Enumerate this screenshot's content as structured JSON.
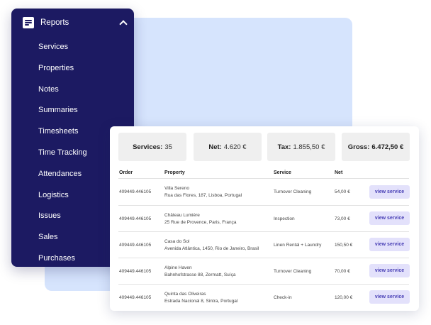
{
  "sidebar": {
    "title": "Reports",
    "header_icon": "document-icon",
    "toggle_icon": "chevron-up-icon",
    "items": [
      {
        "label": "Services"
      },
      {
        "label": "Properties"
      },
      {
        "label": "Notes"
      },
      {
        "label": "Summaries"
      },
      {
        "label": "Timesheets"
      },
      {
        "label": "Time Tracking"
      },
      {
        "label": "Attendances"
      },
      {
        "label": "Logistics"
      },
      {
        "label": "Issues"
      },
      {
        "label": "Sales"
      },
      {
        "label": "Purchases"
      }
    ]
  },
  "summary": {
    "services": {
      "label": "Services:",
      "value": "35"
    },
    "net": {
      "label": "Net:",
      "value": "4.620 €"
    },
    "tax": {
      "label": "Tax:",
      "value": "1.855,50 €"
    },
    "gross": {
      "label": "Gross:",
      "value": "6.472,50 €"
    }
  },
  "table": {
    "columns": {
      "order": "Order",
      "property": "Property",
      "service": "Service",
      "net": "Net"
    },
    "rows": [
      {
        "order": "409449.446105",
        "property_name": "Villa Sereno",
        "property_address": "Rua das Flores, 187, Lisboa, Portugal",
        "service": "Turnover Cleaning",
        "net": "54,00 €",
        "action": "view service"
      },
      {
        "order": "409449.446105",
        "property_name": "Château Lumière",
        "property_address": "25 Rue de Provence, Paris, França",
        "service": "Inspection",
        "net": "73,00 €",
        "action": "view service"
      },
      {
        "order": "409449.446105",
        "property_name": "Casa do Sol",
        "property_address": "Avenida Atlântica, 1450, Rio de Janeiro, Brasil",
        "service": "Linen Rental + Laundry",
        "net": "150,50 €",
        "action": "view service"
      },
      {
        "order": "409449.446105",
        "property_name": "Alpine Haven",
        "property_address": "Bahnhofstrasse 88, Zermatt, Suíça",
        "service": "Turnover Cleaning",
        "net": "70,00 €",
        "action": "view service"
      },
      {
        "order": "409449.446105",
        "property_name": "Quinta das Oliveiras",
        "property_address": "Estrada Nacional 8, Sintra, Portugal",
        "service": "Check-in",
        "net": "120,00 €",
        "action": "view service"
      }
    ]
  },
  "colors": {
    "sidebar_bg": "#1c1a62",
    "backdrop": "#d6e4fd",
    "button_bg": "#e3e1fb",
    "button_text": "#4a41b6"
  }
}
